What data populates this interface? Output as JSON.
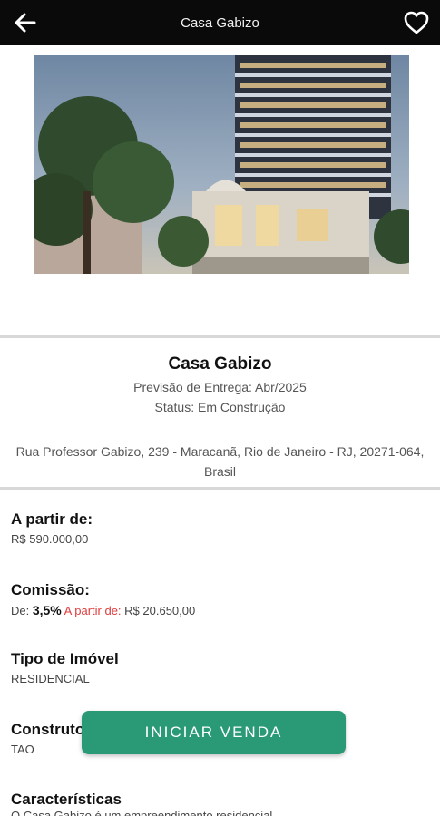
{
  "header": {
    "title": "Casa Gabizo",
    "back_icon": "arrow-left-icon",
    "favorite_icon": "heart-outline-icon"
  },
  "property": {
    "name": "Casa Gabizo",
    "delivery": "Previsão de Entrega: Abr/2025",
    "status": "Status: Em Construção",
    "address": "Rua Professor Gabizo, 239 - Maracanã, Rio de Janeiro - RJ, 20271-064, Brasil"
  },
  "price": {
    "label": "A partir de:",
    "value": "R$ 590.000,00"
  },
  "commission": {
    "label": "Comissão:",
    "prefix": "De: ",
    "percent": "3,5%",
    "from_label": "A partir de:",
    "from_value": "R$ 20.650,00"
  },
  "property_type": {
    "label": "Tipo de Imóvel",
    "value": "RESIDENCIAL"
  },
  "builder": {
    "label": "Construtora",
    "value": "TAO"
  },
  "features": {
    "label": "Características",
    "partial_text": "O Casa Gabizo é um empreendimento residencial"
  },
  "cta": {
    "label": "INICIAR VENDA"
  },
  "colors": {
    "topbar": "#0a0a0a",
    "accent": "#2a9a76",
    "highlight_red": "#e03a3a"
  }
}
